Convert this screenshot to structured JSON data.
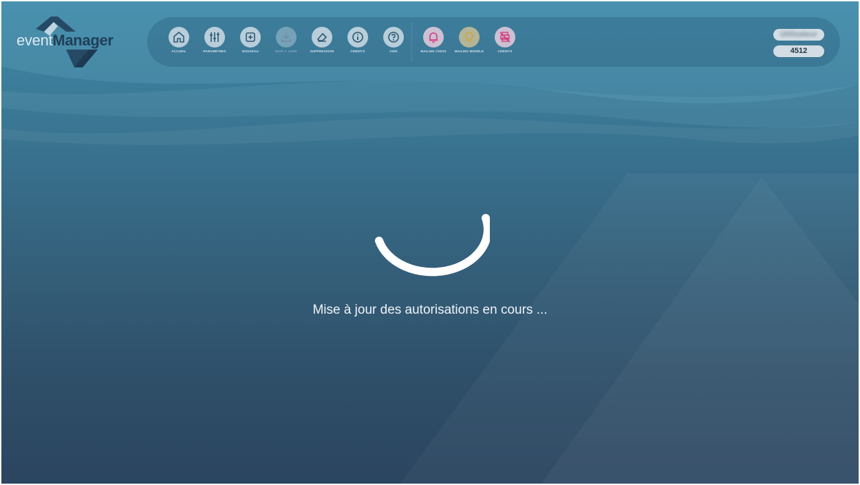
{
  "app": {
    "logo_part1": "event",
    "logo_part2": "Manager"
  },
  "toolbar": {
    "items": [
      {
        "label": "Accueil",
        "icon": "home-icon"
      },
      {
        "label": "Paramètres",
        "icon": "sliders-icon"
      },
      {
        "label": "Nouveau",
        "icon": "plus-square-icon"
      },
      {
        "label": "Mise à jour",
        "icon": "download-icon"
      },
      {
        "label": "Suppression",
        "icon": "eraser-icon"
      },
      {
        "label": "Crédits",
        "icon": "info-icon"
      },
      {
        "label": "Aide",
        "icon": "help-icon"
      },
      {
        "label": "Mailing Choix",
        "icon": "bell-icon"
      },
      {
        "label": "Mailing Modèle",
        "icon": "lightbulb-icon"
      },
      {
        "label": "Crédits",
        "icon": "printer-off-icon"
      }
    ]
  },
  "user": {
    "name": "Utilisateur",
    "id": "4512"
  },
  "status": {
    "message": "Mise à jour des autorisations en cours ..."
  },
  "colors": {
    "accent_pink": "#d23a7c",
    "accent_gold": "#c9a54a",
    "icon_dark": "#2d5670"
  }
}
